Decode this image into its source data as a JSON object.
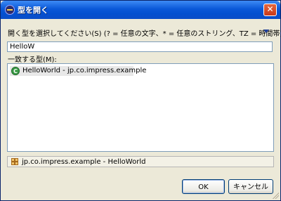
{
  "window": {
    "title": "型を開く",
    "close_glyph": "✕"
  },
  "dialog": {
    "prompt": "開く型を選択してください(S) (? = 任意の文字、* = 任意のストリング、TZ = 時間帯):",
    "filter_value": "HelloW",
    "list_label": "一致する型(M):",
    "types": [
      {
        "name": "HelloWorld - jp.co.impress.example",
        "icon": "class-icon"
      }
    ],
    "status_text": "jp.co.impress.example - HelloWorld",
    "status_icon": "package-icon"
  },
  "buttons": {
    "ok_label": "OK",
    "cancel_label": "キャンセル"
  }
}
